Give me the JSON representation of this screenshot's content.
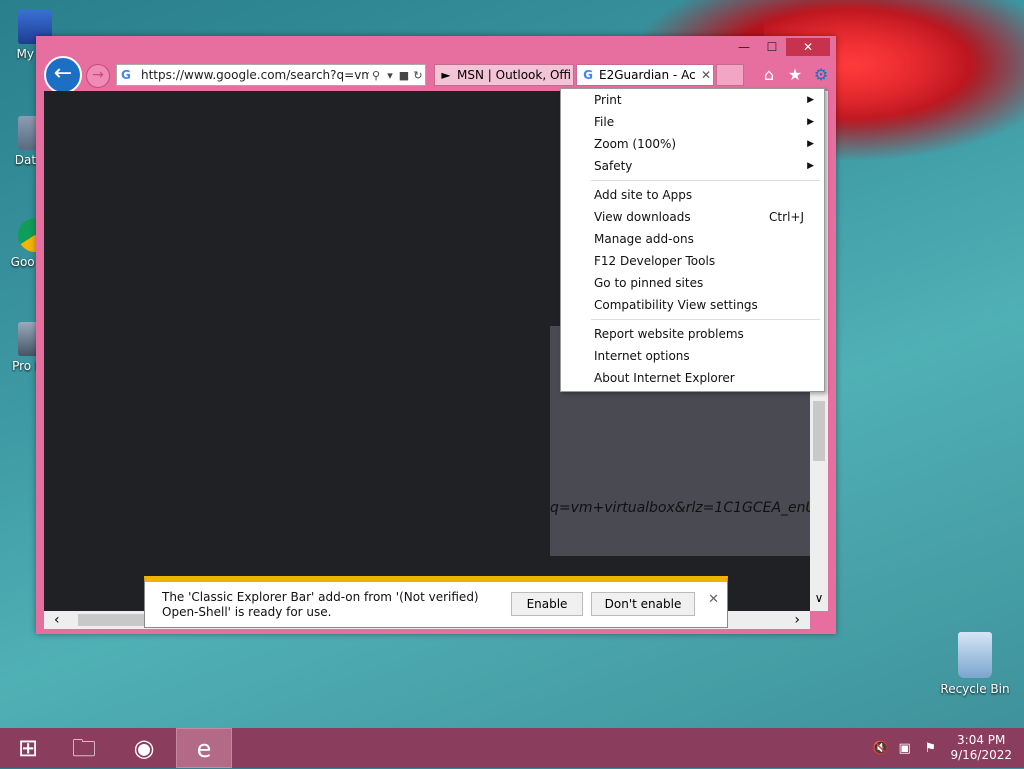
{
  "desktop": {
    "icons": [
      {
        "label": "My Co"
      },
      {
        "label": "DataW"
      },
      {
        "label": "Goo Chr"
      },
      {
        "label": "Pro Hac"
      }
    ],
    "recycle_bin": "Recycle Bin"
  },
  "browser": {
    "address": "https://www.google.com/search?q=vm+",
    "tabs": [
      {
        "label": "MSN | Outlook, Offi"
      },
      {
        "label": "E2Guardian - Ac"
      }
    ],
    "page_text": "q=vm+virtualbox&rlz=1C1GCEA_enU"
  },
  "menu": {
    "items": [
      {
        "label": "Print",
        "submenu": true
      },
      {
        "label": "File",
        "submenu": true
      },
      {
        "label": "Zoom (100%)",
        "submenu": true
      },
      {
        "label": "Safety",
        "submenu": true
      },
      {
        "label": "Add site to Apps"
      },
      {
        "label": "View downloads",
        "shortcut": "Ctrl+J"
      },
      {
        "label": "Manage add-ons"
      },
      {
        "label": "F12 Developer Tools"
      },
      {
        "label": "Go to pinned sites"
      },
      {
        "label": "Compatibility View settings"
      },
      {
        "label": "Report website problems"
      },
      {
        "label": "Internet options"
      },
      {
        "label": "About Internet Explorer"
      }
    ]
  },
  "notification": {
    "line1": "The 'Classic Explorer Bar' add-on from '(Not verified)",
    "line2": "Open-Shell' is ready for use.",
    "enable": "Enable",
    "dont_enable": "Don't enable"
  },
  "taskbar": {
    "time": "3:04 PM",
    "date": "9/16/2022"
  }
}
